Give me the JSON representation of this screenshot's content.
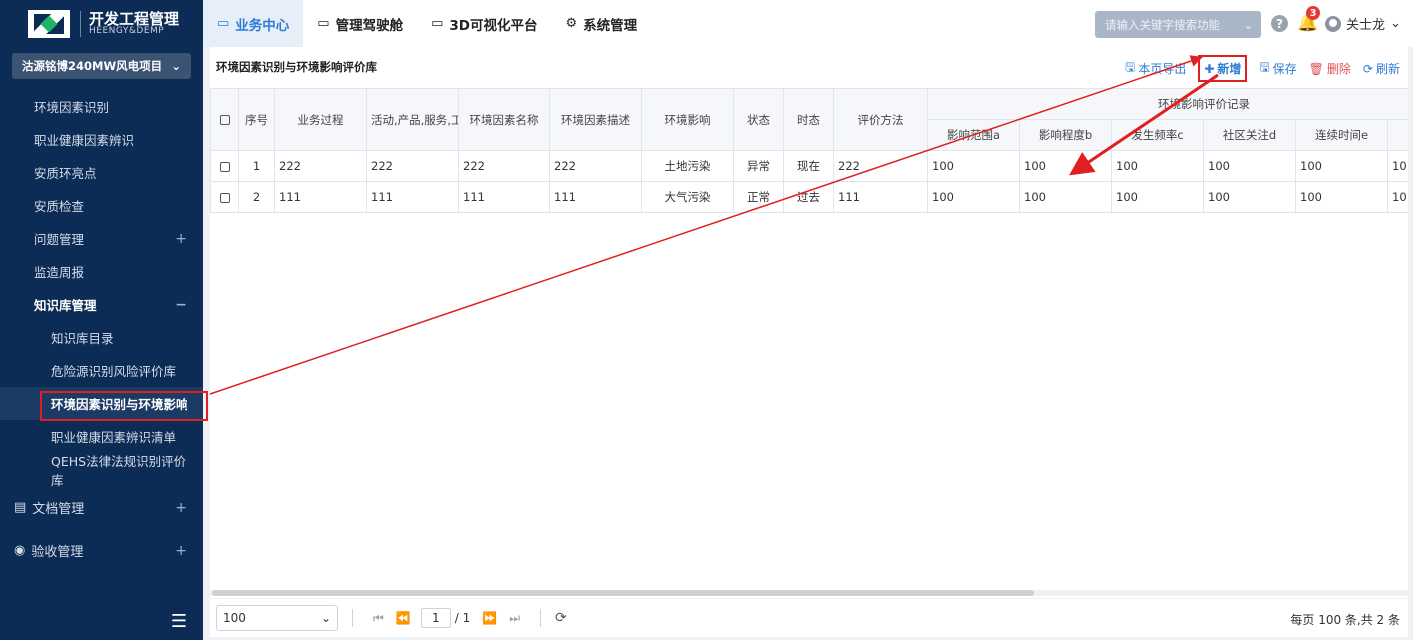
{
  "app": {
    "title": "开发工程管理",
    "subtitle": "HEENGY&DEMP"
  },
  "project": {
    "selected": "沽源铭博240MW风电项目"
  },
  "sidebar": {
    "items": [
      {
        "label": "环境因素识别",
        "level": 1
      },
      {
        "label": "职业健康因素辨识",
        "level": 1
      },
      {
        "label": "安质环亮点",
        "level": 1
      },
      {
        "label": "安质检查",
        "level": 1
      },
      {
        "label": "问题管理",
        "level": 1,
        "expand": "+"
      },
      {
        "label": "监造周报",
        "level": 1
      },
      {
        "label": "知识库管理",
        "level": 1,
        "expand": "−"
      },
      {
        "label": "知识库目录",
        "level": 2
      },
      {
        "label": "危险源识别风险评价库",
        "level": 2
      },
      {
        "label": "环境因素识别与环境影响评",
        "level": 2
      },
      {
        "label": "职业健康因素辨识清单",
        "level": 2
      },
      {
        "label": "QEHS法律法规识别评价库",
        "level": 2
      },
      {
        "label": "文档管理",
        "level": 0,
        "expand": "+"
      },
      {
        "label": "验收管理",
        "level": 0,
        "expand": "+"
      }
    ]
  },
  "topbar": {
    "tabs": [
      {
        "label": "业务中心",
        "icon": "card-icon"
      },
      {
        "label": "管理驾驶舱",
        "icon": "laptop-icon"
      },
      {
        "label": "3D可视化平台",
        "icon": "monitor-icon"
      },
      {
        "label": "系统管理",
        "icon": "gear-icon"
      }
    ],
    "search_placeholder": "请输入关键字搜索功能",
    "notification_count": "3",
    "user_name": "关士龙"
  },
  "panel": {
    "title": "环境因素识别与环境影响评价库",
    "toolbar": {
      "export": "本页导出",
      "add": "新增",
      "save": "保存",
      "delete": "删除",
      "refresh": "刷新"
    }
  },
  "table": {
    "columns": [
      "序号",
      "业务过程",
      "活动,产品,服务,工",
      "环境因素名称",
      "环境因素描述",
      "环境影响",
      "状态",
      "时态",
      "评价方法"
    ],
    "group_header": "环境影响评价记录",
    "sub_columns": [
      "影响范围a",
      "影响程度b",
      "发生频率c",
      "社区关注d",
      "连续时间e"
    ],
    "rows": [
      {
        "no": "1",
        "process": "222",
        "activity": "222",
        "name": "222",
        "desc": "222",
        "impact": "土地污染",
        "status": "异常",
        "tense": "现在",
        "method": "222",
        "a": "100",
        "b": "100",
        "c": "100",
        "d": "100",
        "e": "100",
        "extra": "10"
      },
      {
        "no": "2",
        "process": "111",
        "activity": "111",
        "name": "111",
        "desc": "111",
        "impact": "大气污染",
        "status": "正常",
        "tense": "过去",
        "method": "111",
        "a": "100",
        "b": "100",
        "c": "100",
        "d": "100",
        "e": "100",
        "extra": "10"
      }
    ]
  },
  "pager": {
    "page_size": "100",
    "current_page": "1",
    "total_pages": "/ 1",
    "summary": "每页 100 条,共 2 条"
  }
}
